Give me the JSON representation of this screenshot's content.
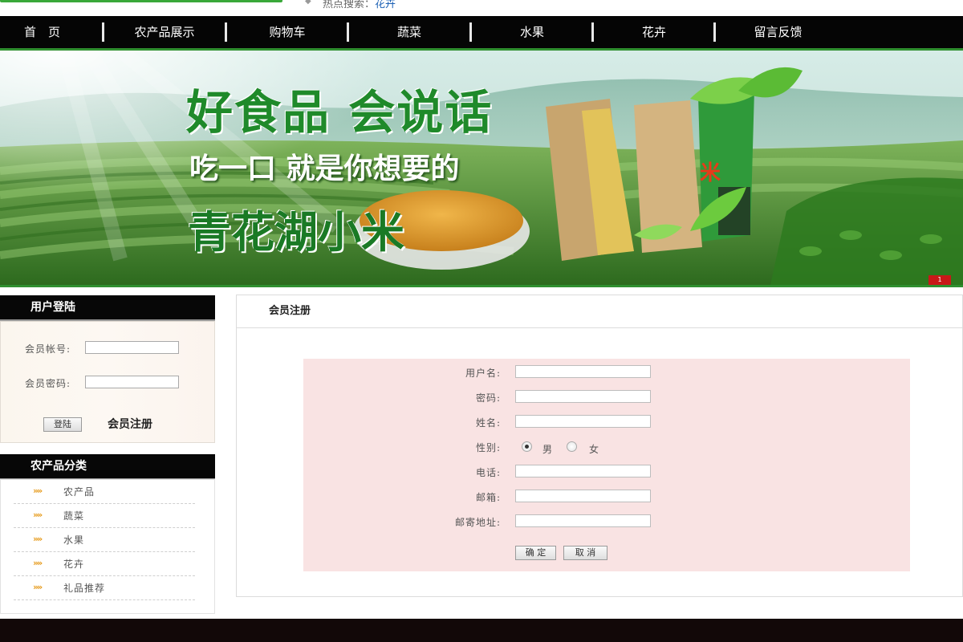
{
  "top": {
    "hot_label": "热点搜索：",
    "hot_keyword": "花卉"
  },
  "nav": {
    "items": [
      "首　页",
      "农产品展示",
      "购物车",
      "蔬菜",
      "水果",
      "花卉",
      "留言反馈"
    ]
  },
  "banner": {
    "headline": "好食品 会说话",
    "subline": "吃一口 就是你想要的",
    "product": "青花湖小米",
    "bag_text": "米",
    "slide_index": "1"
  },
  "login": {
    "title": "用户登陆",
    "account_label": "会员帐号:",
    "password_label": "会员密码:",
    "login_button": "登陆",
    "register_link": "会员注册"
  },
  "categories": {
    "title": "农产品分类",
    "items": [
      "农产品",
      "蔬菜",
      "水果",
      "花卉",
      "礼品推荐"
    ]
  },
  "register": {
    "title": "会员注册",
    "username_label": "用户名:",
    "password_label": "密码:",
    "realname_label": "姓名:",
    "gender_label": "性别:",
    "gender_male": "男",
    "gender_female": "女",
    "phone_label": "电话:",
    "email_label": "邮箱:",
    "address_label": "邮寄地址:",
    "confirm_button": "确 定",
    "cancel_button": "取 消"
  },
  "colors": {
    "nav_bg": "#050505",
    "accent_green": "#2f8f2f",
    "form_bg": "#f9e3e3",
    "footer_bg": "#120808",
    "category_arrow": "#e69a1a"
  },
  "icons": {
    "category_bullet": "double-chevron-right-icon"
  }
}
